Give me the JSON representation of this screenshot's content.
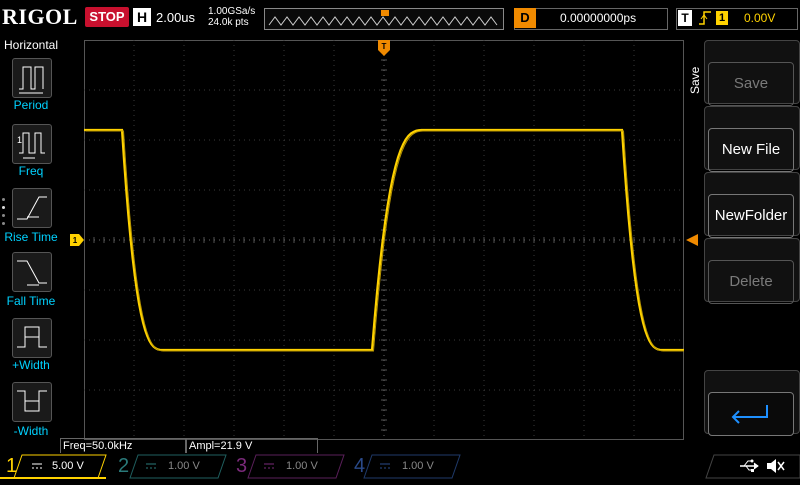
{
  "header": {
    "brand": "RIGOL",
    "run_state": "STOP",
    "horizontal_badge": "H",
    "time_per_div": "2.00us",
    "sample_rate": "1.00GSa/s",
    "memory_depth": "24.0k pts",
    "delay_badge": "D",
    "delay_value": "0.00000000ps",
    "trigger_badge": "T",
    "trigger_channel": "1",
    "trigger_level": "0.00V",
    "trigger_marker": "T"
  },
  "left_menu": {
    "title": "Horizontal",
    "items": [
      {
        "label": "Period",
        "icon": "period-icon"
      },
      {
        "label": "Freq",
        "icon": "frequency-icon"
      },
      {
        "label": "Rise Time",
        "icon": "rise-time-icon"
      },
      {
        "label": "Fall Time",
        "icon": "fall-time-icon"
      },
      {
        "label": "+Width",
        "icon": "positive-width-icon"
      },
      {
        "label": "-Width",
        "icon": "negative-width-icon"
      }
    ]
  },
  "right_menu": {
    "title": "Save",
    "items": [
      {
        "label": "Save",
        "enabled": false
      },
      {
        "label": "New File",
        "enabled": true
      },
      {
        "label": "NewFolder",
        "enabled": true
      },
      {
        "label": "Delete",
        "enabled": false
      },
      {
        "label": "",
        "icon": "return-icon",
        "enabled": true
      }
    ]
  },
  "measurements": {
    "freq": "Freq=50.0kHz",
    "ampl": "Ampl=21.9 V"
  },
  "channels": [
    {
      "number": "1",
      "scale": "5.00 V",
      "color": "#ffd200",
      "active": true
    },
    {
      "number": "2",
      "scale": "1.00 V",
      "color": "#00c8c8",
      "active": false
    },
    {
      "number": "3",
      "scale": "1.00 V",
      "color": "#c828c8",
      "active": false
    },
    {
      "number": "4",
      "scale": "1.00 V",
      "color": "#1e6edc",
      "active": false
    }
  ],
  "markers": {
    "ch1_ground": "1"
  },
  "colors": {
    "trace": "#ffd200",
    "grid": "#444444",
    "accent": "#f08a00",
    "stop": "#c8102e"
  },
  "waveform": {
    "type": "square",
    "time_per_div_us": 2.0,
    "high_divs_above_center": 2.2,
    "low_divs_below_center": 2.2
  }
}
